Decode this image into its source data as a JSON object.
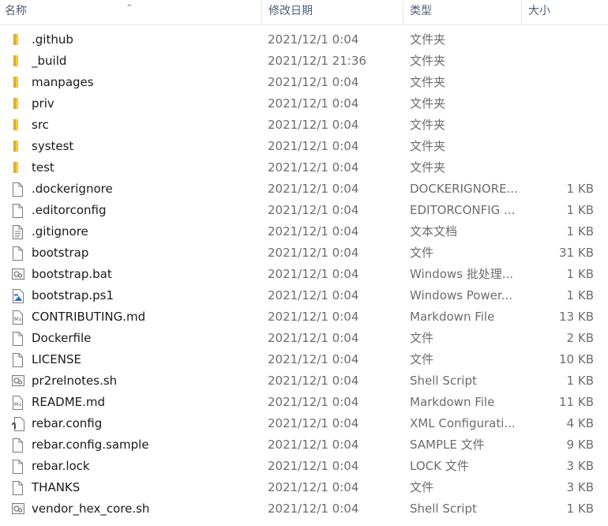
{
  "columns": {
    "name": "名称",
    "date": "修改日期",
    "type": "类型",
    "size": "大小"
  },
  "files": [
    {
      "name": ".github",
      "date": "2021/12/1 0:04",
      "type": "文件夹",
      "size": "",
      "icon": "folder-icon"
    },
    {
      "name": "_build",
      "date": "2021/12/1 21:36",
      "type": "文件夹",
      "size": "",
      "icon": "folder-icon"
    },
    {
      "name": "manpages",
      "date": "2021/12/1 0:04",
      "type": "文件夹",
      "size": "",
      "icon": "folder-icon"
    },
    {
      "name": "priv",
      "date": "2021/12/1 0:04",
      "type": "文件夹",
      "size": "",
      "icon": "folder-icon"
    },
    {
      "name": "src",
      "date": "2021/12/1 0:04",
      "type": "文件夹",
      "size": "",
      "icon": "folder-icon"
    },
    {
      "name": "systest",
      "date": "2021/12/1 0:04",
      "type": "文件夹",
      "size": "",
      "icon": "folder-icon"
    },
    {
      "name": "test",
      "date": "2021/12/1 0:04",
      "type": "文件夹",
      "size": "",
      "icon": "folder-icon"
    },
    {
      "name": ".dockerignore",
      "date": "2021/12/1 0:04",
      "type": "DOCKERIGNORE...",
      "size": "1 KB",
      "icon": "file-icon"
    },
    {
      "name": ".editorconfig",
      "date": "2021/12/1 0:04",
      "type": "EDITORCONFIG ...",
      "size": "1 KB",
      "icon": "file-icon"
    },
    {
      "name": ".gitignore",
      "date": "2021/12/1 0:04",
      "type": "文本文档",
      "size": "1 KB",
      "icon": "text-file-icon"
    },
    {
      "name": "bootstrap",
      "date": "2021/12/1 0:04",
      "type": "文件",
      "size": "31 KB",
      "icon": "file-icon"
    },
    {
      "name": "bootstrap.bat",
      "date": "2021/12/1 0:04",
      "type": "Windows 批处理...",
      "size": "1 KB",
      "icon": "batch-file-icon"
    },
    {
      "name": "bootstrap.ps1",
      "date": "2021/12/1 0:04",
      "type": "Windows Power...",
      "size": "1 KB",
      "icon": "powershell-file-icon"
    },
    {
      "name": "CONTRIBUTING.md",
      "date": "2021/12/1 0:04",
      "type": "Markdown File",
      "size": "13 KB",
      "icon": "markdown-file-icon"
    },
    {
      "name": "Dockerfile",
      "date": "2021/12/1 0:04",
      "type": "文件",
      "size": "2 KB",
      "icon": "file-icon"
    },
    {
      "name": "LICENSE",
      "date": "2021/12/1 0:04",
      "type": "文件",
      "size": "10 KB",
      "icon": "file-icon"
    },
    {
      "name": "pr2relnotes.sh",
      "date": "2021/12/1 0:04",
      "type": "Shell Script",
      "size": "1 KB",
      "icon": "script-file-icon"
    },
    {
      "name": "README.md",
      "date": "2021/12/1 0:04",
      "type": "Markdown File",
      "size": "11 KB",
      "icon": "markdown-file-icon"
    },
    {
      "name": "rebar.config",
      "date": "2021/12/1 0:04",
      "type": "XML Configurati...",
      "size": "4 KB",
      "icon": "xml-config-file-icon"
    },
    {
      "name": "rebar.config.sample",
      "date": "2021/12/1 0:04",
      "type": "SAMPLE 文件",
      "size": "9 KB",
      "icon": "file-icon"
    },
    {
      "name": "rebar.lock",
      "date": "2021/12/1 0:04",
      "type": "LOCK 文件",
      "size": "3 KB",
      "icon": "file-icon"
    },
    {
      "name": "THANKS",
      "date": "2021/12/1 0:04",
      "type": "文件",
      "size": "3 KB",
      "icon": "file-icon"
    },
    {
      "name": "vendor_hex_core.sh",
      "date": "2021/12/1 0:04",
      "type": "Shell Script",
      "size": "1 KB",
      "icon": "script-file-icon"
    }
  ],
  "colors": {
    "folder": "#e8b73d",
    "header_text": "#4c607a",
    "secondary_text": "#6d6d6d"
  }
}
